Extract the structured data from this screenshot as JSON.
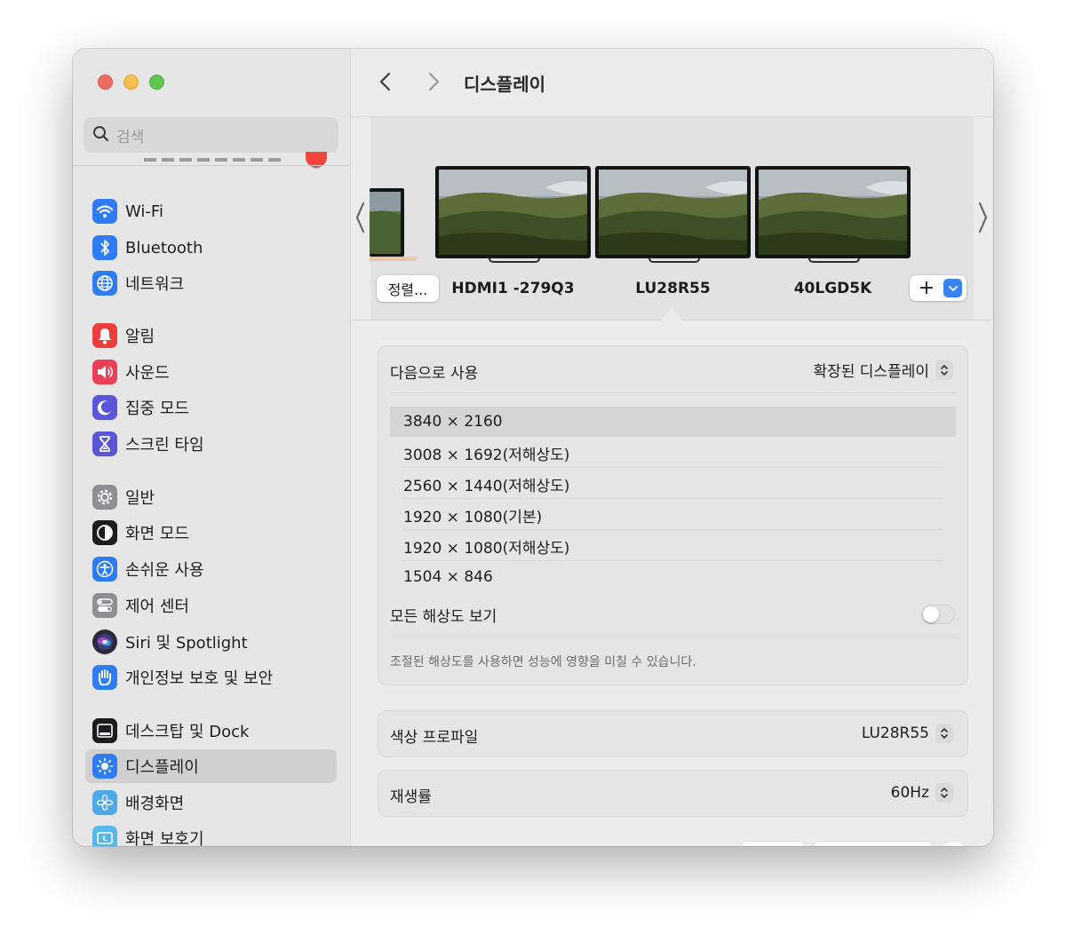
{
  "window": {
    "title": "디스플레이"
  },
  "sidebar": {
    "search_placeholder": "검색",
    "groups": [
      {
        "items": [
          {
            "label": "Wi-Fi",
            "icon": "wifi-icon",
            "color": "#2f7cf6"
          },
          {
            "label": "Bluetooth",
            "icon": "bluetooth-icon",
            "color": "#2f7cf6"
          },
          {
            "label": "네트워크",
            "icon": "globe-icon",
            "color": "#2f7cf6"
          }
        ]
      },
      {
        "items": [
          {
            "label": "알림",
            "icon": "bell-icon",
            "color": "#ec3e3a"
          },
          {
            "label": "사운드",
            "icon": "speaker-icon",
            "color": "#ec3e56"
          },
          {
            "label": "집중 모드",
            "icon": "moon-icon",
            "color": "#5b55d8"
          },
          {
            "label": "스크린 타임",
            "icon": "hourglass-icon",
            "color": "#5b55d8"
          }
        ]
      },
      {
        "items": [
          {
            "label": "일반",
            "icon": "gear-icon",
            "color": "#8e8e93"
          },
          {
            "label": "화면 모드",
            "icon": "appearance-icon",
            "color": "#1c1c1e"
          },
          {
            "label": "손쉬운 사용",
            "icon": "accessibility-icon",
            "color": "#2f7cf6"
          },
          {
            "label": "제어 센터",
            "icon": "control-center-icon",
            "color": "#8e8e93"
          },
          {
            "label": "Siri 및 Spotlight",
            "icon": "siri-icon",
            "color": "#2a2a3a"
          },
          {
            "label": "개인정보 보호 및 보안",
            "icon": "hand-icon",
            "color": "#2f7cf6"
          }
        ]
      },
      {
        "items": [
          {
            "label": "데스크탑 및 Dock",
            "icon": "dock-icon",
            "color": "#1c1c1e"
          },
          {
            "label": "디스플레이",
            "icon": "brightness-icon",
            "color": "#2f7cf6",
            "active": true
          },
          {
            "label": "배경화면",
            "icon": "flower-icon",
            "color": "#4fa8e8"
          },
          {
            "label": "화면 보호기",
            "icon": "screensaver-icon",
            "color": "#5ab8e8"
          }
        ]
      }
    ]
  },
  "arrangement": {
    "arrange_button": "정렬...",
    "monitors": [
      "HDMI1 -279Q3",
      "LU28R55",
      "40LGD5K"
    ],
    "selected_monitor": "LU28R55",
    "add_button": "+"
  },
  "use_as": {
    "label": "다음으로 사용",
    "value": "확장된 디스플레이"
  },
  "resolutions": {
    "items": [
      "3840 × 2160",
      "3008 × 1692(저해상도)",
      "2560 × 1440(저해상도)",
      "1920 × 1080(기본)",
      "1920 × 1080(저해상도)",
      "1504 × 846"
    ],
    "selected_index": 0,
    "show_all_label": "모든 해상도 보기",
    "show_all_on": false,
    "note": "조절된 해상도를 사용하면 성능에 영향을 미칠 수 있습니다."
  },
  "color_profile": {
    "label": "색상 프로파일",
    "value": "LU28R55"
  },
  "refresh_rate": {
    "label": "재생률",
    "value": "60Hz"
  }
}
